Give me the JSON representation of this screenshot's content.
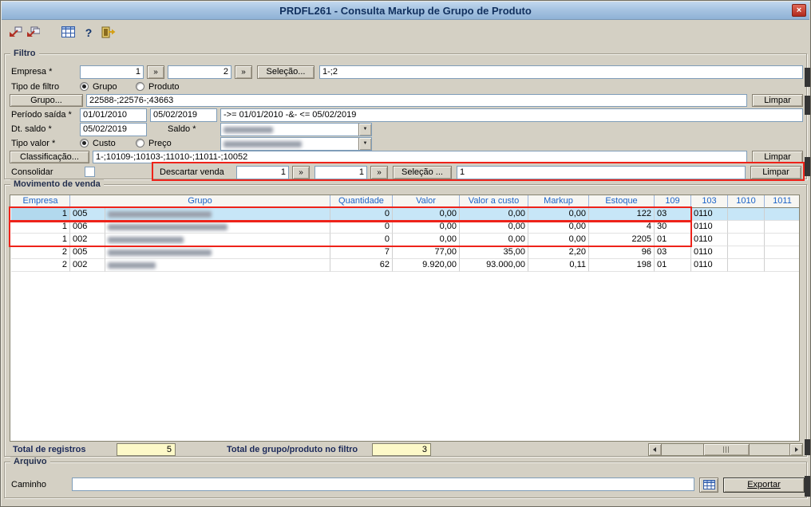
{
  "window": {
    "title": "PRDFL261 - Consulta Markup de Grupo de Produto",
    "close_glyph": "×"
  },
  "toolbar": {
    "help_glyph": "?"
  },
  "filter": {
    "legend": "Filtro",
    "empresa_label": "Empresa *",
    "empresa_from": "1",
    "empresa_to": "2",
    "range_glyph": "»",
    "selecao_button": "Seleção...",
    "empresa_result": "1-;2",
    "tipo_filtro_label": "Tipo de filtro",
    "radio_grupo": "Grupo",
    "radio_produto": "Produto",
    "grupo_button": "Grupo...",
    "grupo_value": "22588-;22576-;43663",
    "limpar_button": "Limpar",
    "periodo_label": "Período saída *",
    "periodo_from": "01/01/2010",
    "periodo_to": "05/02/2019",
    "periodo_result": "->= 01/01/2010 -&- <= 05/02/2019",
    "dt_saldo_label": "Dt. saldo *",
    "dt_saldo_value": "05/02/2019",
    "saldo_label": "Saldo *",
    "tipo_valor_label": "Tipo valor *",
    "radio_custo": "Custo",
    "radio_preco": "Preço",
    "classificacao_button": "Classificação...",
    "classificacao_value": "1-;10109-;10103-;11010-;11011-;10052",
    "consolidar_label": "Consolidar",
    "descartar_label": "Descartar venda",
    "descartar_from": "1",
    "descartar_to": "1",
    "descartar_selecao_button": "Seleção ...",
    "descartar_result": "1"
  },
  "grid": {
    "legend": "Movimento de venda",
    "columns": {
      "empresa": "Empresa",
      "grupo": "Grupo",
      "quantidade": "Quantidade",
      "valor": "Valor",
      "valor_custo": "Valor a custo",
      "markup": "Markup",
      "estoque": "Estoque",
      "c109": "109",
      "c103": "103",
      "c1010": "1010",
      "c1011": "1011"
    },
    "rows": [
      {
        "empresa": "1",
        "grupo_cod": "005",
        "quantidade": "0",
        "valor": "0,00",
        "valor_custo": "0,00",
        "markup": "0,00",
        "estoque": "122",
        "c109": "03",
        "c103": "0110",
        "c1010": "",
        "c1011": ""
      },
      {
        "empresa": "1",
        "grupo_cod": "006",
        "quantidade": "0",
        "valor": "0,00",
        "valor_custo": "0,00",
        "markup": "0,00",
        "estoque": "4",
        "c109": "30",
        "c103": "0110",
        "c1010": "",
        "c1011": ""
      },
      {
        "empresa": "1",
        "grupo_cod": "002",
        "quantidade": "0",
        "valor": "0,00",
        "valor_custo": "0,00",
        "markup": "0,00",
        "estoque": "2205",
        "c109": "01",
        "c103": "0110",
        "c1010": "",
        "c1011": ""
      },
      {
        "empresa": "2",
        "grupo_cod": "005",
        "quantidade": "7",
        "valor": "77,00",
        "valor_custo": "35,00",
        "markup": "2,20",
        "estoque": "96",
        "c109": "03",
        "c103": "0110",
        "c1010": "",
        "c1011": ""
      },
      {
        "empresa": "2",
        "grupo_cod": "002",
        "quantidade": "62",
        "valor": "9.920,00",
        "valor_custo": "93.000,00",
        "markup": "0,11",
        "estoque": "198",
        "c109": "01",
        "c103": "0110",
        "c1010": "",
        "c1011": ""
      }
    ]
  },
  "totals": {
    "registros_label": "Total de registros",
    "registros_value": "5",
    "filtro_label": "Total de grupo/produto no filtro",
    "filtro_value": "3"
  },
  "arquivo": {
    "legend": "Arquivo",
    "caminho_label": "Caminho",
    "caminho_value": "",
    "exportar_button": "Exportar"
  }
}
